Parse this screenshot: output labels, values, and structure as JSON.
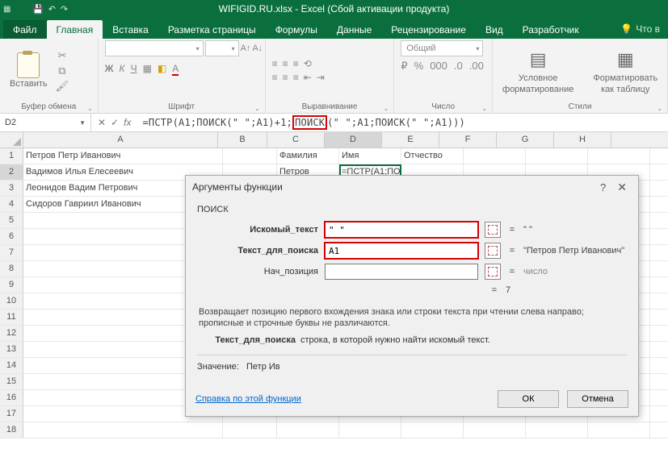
{
  "window": {
    "title": "WIFIGID.RU.xlsx - Excel (Сбой активации продукта)"
  },
  "tabs": {
    "file": "Файл",
    "home": "Главная",
    "insert": "Вставка",
    "layout": "Разметка страницы",
    "formulas": "Формулы",
    "data": "Данные",
    "review": "Рецензирование",
    "view": "Вид",
    "dev": "Разработчик",
    "tellme": "Что в"
  },
  "ribbon": {
    "paste": "Вставить",
    "clipboard": "Буфер обмена",
    "font_name": "",
    "font_size": "",
    "font_group": "Шрифт",
    "align_group": "Выравнивание",
    "number_format": "Общий",
    "number_group": "Число",
    "cond": "Условное",
    "cond2": "форматирование",
    "table": "Форматировать",
    "table2": "как таблицу",
    "styles_group": "Стили"
  },
  "namebox": "D2",
  "formula": {
    "pre": "=ПСТР(A1;ПОИСК(\" \";A1)+1;",
    "hl": "ПОИСК",
    "post": "(\" \";A1;ПОИСК(\" \";A1)))"
  },
  "cols": [
    "A",
    "B",
    "C",
    "D",
    "E",
    "F",
    "G",
    "H"
  ],
  "rows": [
    1,
    2,
    3,
    4,
    5,
    6,
    7,
    8,
    9,
    10,
    11,
    12,
    13,
    14,
    15,
    16,
    17,
    18
  ],
  "cells": {
    "A1": "Петров Петр Иванович",
    "A2": "Вадимов Илья Елесеевич",
    "A3": "Леонидов Вадим Петрович",
    "A4": "Сидоров Гавриил Иванович",
    "C1": "Фамилия",
    "D1": "Имя",
    "E1": "Отчество",
    "C2": "Петров",
    "D2": "=ПСТР(A1;ПОИСК(\" \";A1)+1;ПОИСК(\" \";A1;ПОИСК(\" \";A1)))"
  },
  "dialog": {
    "title": "Аргументы функции",
    "fn": "ПОИСК",
    "arg1_label": "Искомый_текст",
    "arg1_val": "\" \"",
    "arg1_res": "\" \"",
    "arg2_label": "Текст_для_поиска",
    "arg2_val": "A1",
    "arg2_res": "\"Петров Петр Иванович\"",
    "arg3_label": "Нач_позиция",
    "arg3_val": "",
    "arg3_res": "число",
    "out_label": "=",
    "out_val": "7",
    "desc": "Возвращает позицию первого вхождения знака или строки текста при чтении слева направо; прописные и строчные буквы не различаются.",
    "desc2_label": "Текст_для_поиска",
    "desc2_text": "строка, в которой нужно найти искомый текст.",
    "value_label": "Значение:",
    "value": "Петр Ив",
    "help": "Справка по этой функции",
    "ok": "ОК",
    "cancel": "Отмена"
  },
  "chart_data": null
}
